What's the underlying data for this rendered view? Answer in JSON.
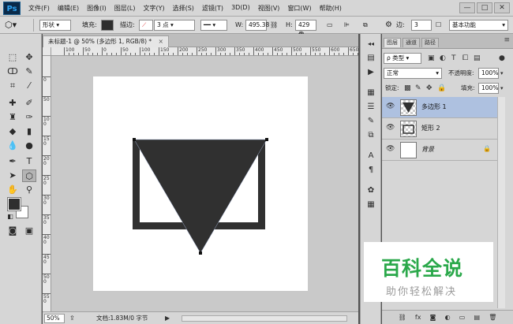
{
  "menubar": {
    "logo": "Ps",
    "items": [
      "文件(F)",
      "编辑(E)",
      "图像(I)",
      "图层(L)",
      "文字(Y)",
      "选择(S)",
      "滤镜(T)",
      "3D(D)",
      "视图(V)",
      "窗口(W)",
      "帮助(H)"
    ],
    "window_controls": [
      "—",
      "□",
      "✕"
    ]
  },
  "options": {
    "mode": "形状",
    "fill_label": "填充:",
    "stroke_label": "描边:",
    "stroke_width": "3 点",
    "w_label": "W:",
    "w_value": "495.38",
    "h_label": "H:",
    "h_value": "429 像",
    "edges_label": "边:",
    "edges_value": "3",
    "workspace": "基本功能"
  },
  "document": {
    "tab_title": "未标题-1 @ 50% (多边形 1, RGB/8) *",
    "tab_close": "×",
    "ruler_h_labels": [
      "100",
      "50",
      "0",
      "50",
      "100",
      "150",
      "200",
      "250",
      "300",
      "350",
      "400",
      "450",
      "500",
      "550",
      "600",
      "650",
      "700"
    ],
    "ruler_v_labels": [
      "0",
      "50",
      "100",
      "150",
      "200",
      "250",
      "300",
      "350",
      "400",
      "450",
      "500",
      "550"
    ]
  },
  "status": {
    "zoom": "50%",
    "doc_info": "文档:1.83M/0 字节",
    "arrow": "▶"
  },
  "layers_panel": {
    "tabs": [
      "图层",
      "通道",
      "路径"
    ],
    "filter_kind": "ρ 类型",
    "blend_mode": "正常",
    "opacity_label": "不透明度:",
    "opacity_value": "100%",
    "lock_label": "锁定:",
    "fill_label": "填充:",
    "fill_value": "100%",
    "layers": [
      {
        "name": "多边形 1",
        "selected": true
      },
      {
        "name": "矩形 2",
        "selected": false
      },
      {
        "name": "背景",
        "selected": false,
        "locked": true
      }
    ]
  },
  "watermark": {
    "title": "百科全说",
    "subtitle": "助你轻松解决"
  },
  "colors": {
    "foreground": "#2f2f2f",
    "background": "#ffffff",
    "shape": "#303030",
    "selection": "#aec1e0",
    "watermark_green": "#2aa84a"
  }
}
